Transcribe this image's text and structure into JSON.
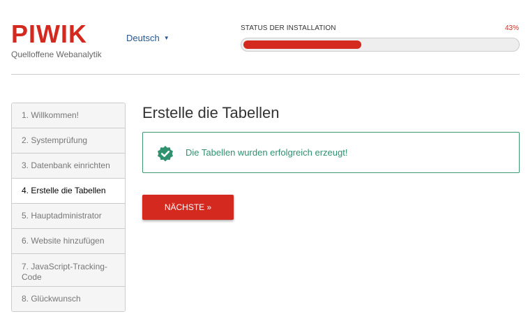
{
  "brand": {
    "logo_text": "PIWIK",
    "tagline": "Quelloffene Webanalytik",
    "accent_color": "#d4291f"
  },
  "language": {
    "selected": "Deutsch",
    "caret": "▼"
  },
  "install_status": {
    "label": "STATUS DER INSTALLATION",
    "percent_text": "43%",
    "progress_fraction": 0.43
  },
  "steps": [
    {
      "label": "1. Willkommen!",
      "active": false
    },
    {
      "label": "2. Systemprüfung",
      "active": false
    },
    {
      "label": "3. Datenbank einrichten",
      "active": false
    },
    {
      "label": "4. Erstelle die Tabellen",
      "active": true
    },
    {
      "label": "5. Hauptadministrator",
      "active": false
    },
    {
      "label": "6. Website hinzufügen",
      "active": false
    },
    {
      "label": "7. JavaScript-Tracking-Code",
      "active": false
    },
    {
      "label": "8. Glückwunsch",
      "active": false
    }
  ],
  "main": {
    "title": "Erstelle die Tabellen",
    "success_message": "Die Tabellen wurden erfolgreich erzeugt!",
    "success_icon": "check-badge-icon",
    "next_button": "NÄCHSTE »"
  }
}
